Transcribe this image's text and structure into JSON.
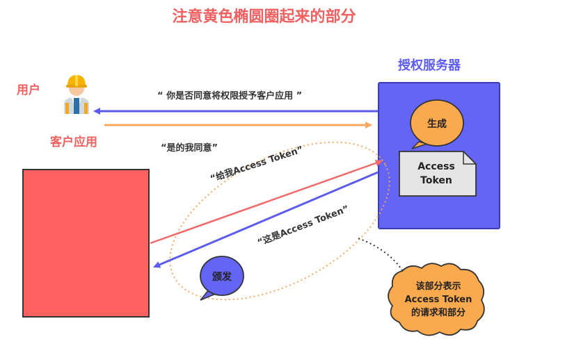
{
  "title": "注意黄色椭圆圈起来的部分",
  "labels": {
    "user": "用户",
    "client_app": "客户应用",
    "auth_server": "授权服务器"
  },
  "quotes": {
    "ask_consent": "“ 你是否同意将权限授予客户应用 ”",
    "agree": "“是的我同意”",
    "give_token": "“给我Access Token”",
    "here_token": "“这是Access Token”"
  },
  "bubbles": {
    "generate": "生成",
    "issue": "颁发"
  },
  "token_doc": {
    "line1": "Access",
    "line2": "Token"
  },
  "note": {
    "line1": "该部分表示",
    "line2": "Access Token",
    "line3": "的请求和部分"
  },
  "colors": {
    "accent_red": "#f06060",
    "server_blue": "#6464f5",
    "client_red": "#ff6060",
    "orange": "#fba94f",
    "arrow_blue": "#5c5cf0",
    "arrow_orange": "#f8a860",
    "arrow_red": "#f06a6a"
  },
  "icons": {
    "user": "worker-with-helmet-icon"
  }
}
